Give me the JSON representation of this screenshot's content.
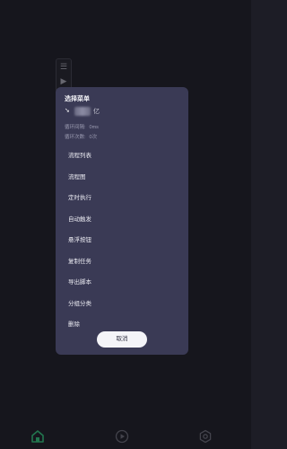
{
  "background": {
    "top_right_label": "",
    "toolbar": {
      "icons": [
        "list-icon",
        "play-icon"
      ]
    },
    "bottom_hints": [
      "",
      ""
    ],
    "bottom_nav": {
      "icons": [
        "home-icon",
        "play-circle-icon",
        "settings-icon"
      ],
      "active_color": "#2e9e6a"
    }
  },
  "dialog": {
    "title": "选择菜单",
    "username_suffix": "亿",
    "loop_interval_label": "循环间隔:",
    "loop_interval_value": "0ms",
    "loop_count_label": "循环次数:",
    "loop_count_value": "0次",
    "menu_items": [
      "流程列表",
      "流程图",
      "定时执行",
      "自动触发",
      "悬浮按钮",
      "复制任务",
      "导出脚本",
      "分组分类",
      "删除"
    ],
    "cancel_label": "取消"
  },
  "colors": {
    "dialog_bg": "#3a3a55",
    "page_bg": "#1d1d26",
    "cancel_bg": "#f4f4f8"
  }
}
